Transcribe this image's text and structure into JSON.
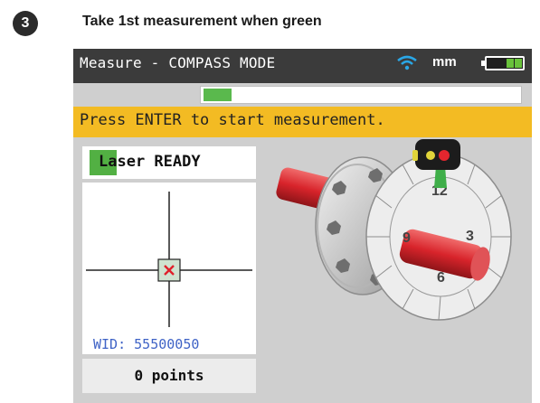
{
  "step": {
    "number": "3",
    "title": "Take 1st measurement when green"
  },
  "screen": {
    "title": "Measure - COMPASS MODE",
    "wifi_icon": "wifi-icon",
    "unit": "mm",
    "battery_icon": "battery-icon",
    "progress": 0.09,
    "prompt": "Press ENTER to start measurement.",
    "laser_status": "Laser READY",
    "wid": "WID: 55500050",
    "points": "0 points",
    "dial_numbers": [
      "12",
      "3",
      "6",
      "9"
    ]
  },
  "colors": {
    "titlebar": "#3b3b3b",
    "prompt_bar": "#f3bb23",
    "ready_green": "#52b043",
    "wid_blue": "#3f63c6",
    "rotor_red": "#d8242b"
  }
}
